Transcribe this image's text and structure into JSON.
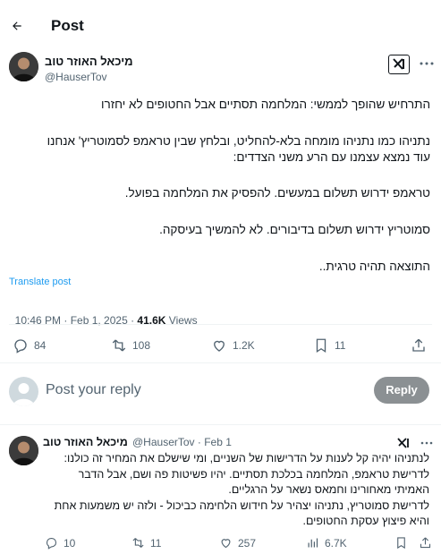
{
  "header": {
    "title": "Post"
  },
  "post": {
    "author_name": "מיכאל האוזר טוב",
    "author_handle": "@HauserTov",
    "paragraphs": [
      "התרחיש שהופך לממשי: המלחמה תסתיים אבל החטופים לא יחזרו",
      "נתניהו כמו נתניהו מומחה בלא-להחליט, ובלחץ שבין טראמפ לסמוטריץ' אנחנו",
      "עוד נמצא עצמנו עם הרע משני הצדדים:",
      "טראמפ ידרוש תשלום במעשים. להפסיק את המלחמה בפועל.",
      "סמוטריץ ידרוש תשלום בדיבורים. לא להמשיך בעיסקה.",
      "התוצאה תהיה טרגית.."
    ],
    "translate_label": "Translate post",
    "timestamp": "10:46 PM · Feb 1, 2025 · ",
    "views_count": "41.6K",
    "views_label": " Views",
    "actions": {
      "replies": "84",
      "reposts": "108",
      "likes": "1.2K",
      "bookmarks": "11"
    }
  },
  "reply_box": {
    "placeholder": "Post your reply",
    "button_label": "Reply"
  },
  "reply": {
    "author_name": "מיכאל האוזר טוב",
    "meta": "@HauserTov · Feb 1",
    "lines": [
      "לנתניהו יהיה קל לענות על הדרישות של השניים, ומי שישלם את המחיר זה כולנו:",
      "לדרישת טראמפ, המלחמה בכלכת תסתיים. יהיו פשיטות פה ושם, אבל הדבר",
      "האמיתי מאחורינו וחמאס נשאר על הרגליים.",
      "לדרישת סמוטריץ, נתניהו יצהיר על חידוש הלחימה כביכול - ולזה יש משמעות אחת",
      "והיא פיצוץ עסקת החטופים."
    ],
    "actions": {
      "replies": "10",
      "reposts": "11",
      "likes": "257",
      "views": "6.7K"
    }
  },
  "colors": {
    "accent": "#1d9bf0",
    "text": "#0f1419",
    "muted": "#536471",
    "divider": "#eff3f4",
    "reply_button": "#8b9093"
  }
}
